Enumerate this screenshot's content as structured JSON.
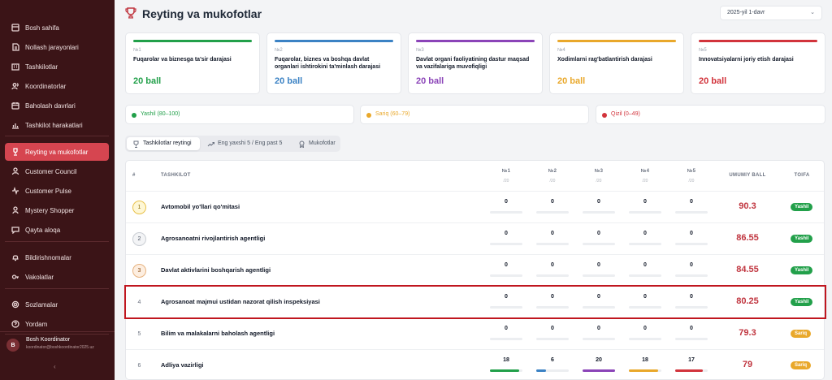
{
  "sidebar": {
    "items": [
      {
        "label": "Bosh sahifa",
        "icon": "home-icon"
      },
      {
        "label": "Nollash jarayonlari",
        "icon": "document-icon"
      },
      {
        "label": "Tashkilotlar",
        "icon": "building-icon"
      },
      {
        "label": "Koordinatorlar",
        "icon": "users-icon"
      },
      {
        "label": "Baholash davrlari",
        "icon": "calendar-icon"
      },
      {
        "label": "Tashkilot harakatlari",
        "icon": "chart-icon"
      },
      {
        "label": "Reyting va mukofotlar",
        "icon": "trophy-icon",
        "active": true
      },
      {
        "label": "Customer Council",
        "icon": "people-icon"
      },
      {
        "label": "Customer Pulse",
        "icon": "pulse-icon"
      },
      {
        "label": "Mystery Shopper",
        "icon": "shopper-icon"
      },
      {
        "label": "Qayta aloqa",
        "icon": "chat-icon"
      },
      {
        "label": "Bildirishnomalar",
        "icon": "bell-icon"
      },
      {
        "label": "Vakolatlar",
        "icon": "key-icon"
      },
      {
        "label": "Sozlamalar",
        "icon": "settings-icon"
      },
      {
        "label": "Yordam",
        "icon": "help-icon"
      }
    ],
    "user": {
      "initial": "B",
      "name": "Bosh Koordinator",
      "email": "koordinator@boshkoordinator2025.uz"
    }
  },
  "header": {
    "title": "Reyting va mukofotlar",
    "period": "2025-yil 1-davr"
  },
  "criteria": [
    {
      "num": "№1",
      "title": "Fuqarolar va biznesga ta'sir darajasi",
      "score": "20 ball",
      "color": "#22a04a"
    },
    {
      "num": "№2",
      "title": "Fuqarolar, biznes va boshqa davlat organlari ishtirokini ta'minlash darajasi",
      "score": "20 ball",
      "color": "#3b82c4"
    },
    {
      "num": "№3",
      "title": "Davlat organi faoliyatining dastur maqsad va vazifalariga muvofiqligi",
      "score": "20 ball",
      "color": "#8b44b8"
    },
    {
      "num": "№4",
      "title": "Xodimlarni rag'batlantirish darajasi",
      "score": "20 ball",
      "color": "#e9a82b"
    },
    {
      "num": "№5",
      "title": "Innovatsiyalarni joriy etish darajasi",
      "score": "20 ball",
      "color": "#d2343c"
    }
  ],
  "legend": [
    {
      "label": "Yashil (80–100)",
      "color": "#22a04a"
    },
    {
      "label": "Sariq (60–79)",
      "color": "#e9a82b"
    },
    {
      "label": "Qizil (0–49)",
      "color": "#d2343c"
    }
  ],
  "tabs": [
    {
      "label": "Tashkilotlar reytingi",
      "active": true
    },
    {
      "label": "Eng yaxshi 5 / Eng past 5"
    },
    {
      "label": "Mukofotlar"
    }
  ],
  "table": {
    "headers": {
      "rank": "#",
      "org": "TASHKILOT",
      "c1": "№1",
      "c2": "№2",
      "c3": "№3",
      "c4": "№4",
      "c5": "№5",
      "sub": "/20",
      "total": "UMUMIY BALL",
      "cat": "TOIFA"
    },
    "rows": [
      {
        "rank": "1",
        "name": "Avtomobil yo'llari qo'mitasi",
        "scores": [
          "0",
          "0",
          "0",
          "0",
          "0"
        ],
        "fills": [
          0,
          0,
          0,
          0,
          0
        ],
        "total": "90.3",
        "cat": "Yashil",
        "catColor": "#22a04a",
        "medal": "gold"
      },
      {
        "rank": "2",
        "name": "Agrosanoatni rivojlantirish agentligi",
        "scores": [
          "0",
          "0",
          "0",
          "0",
          "0"
        ],
        "fills": [
          0,
          0,
          0,
          0,
          0
        ],
        "total": "86.55",
        "cat": "Yashil",
        "catColor": "#22a04a",
        "medal": "silver"
      },
      {
        "rank": "3",
        "name": "Davlat aktivlarini boshqarish agentligi",
        "scores": [
          "0",
          "0",
          "0",
          "0",
          "0"
        ],
        "fills": [
          0,
          0,
          0,
          0,
          0
        ],
        "total": "84.55",
        "cat": "Yashil",
        "catColor": "#22a04a",
        "medal": "bronze"
      },
      {
        "rank": "4",
        "name": "Agrosanoat majmui ustidan nazorat qilish inspeksiyasi",
        "scores": [
          "0",
          "0",
          "0",
          "0",
          "0"
        ],
        "fills": [
          0,
          0,
          0,
          0,
          0
        ],
        "total": "80.25",
        "cat": "Yashil",
        "catColor": "#22a04a",
        "medal": ""
      },
      {
        "rank": "5",
        "name": "Bilim va malakalarni baholash agentligi",
        "scores": [
          "0",
          "0",
          "0",
          "0",
          "0"
        ],
        "fills": [
          0,
          0,
          0,
          0,
          0
        ],
        "total": "79.3",
        "cat": "Sariq",
        "catColor": "#e9a82b",
        "medal": ""
      },
      {
        "rank": "6",
        "name": "Adliya vazirligi",
        "scores": [
          "18",
          "6",
          "20",
          "18",
          "17"
        ],
        "fills": [
          0.9,
          0.3,
          1,
          0.9,
          0.85
        ],
        "total": "79",
        "cat": "Sariq",
        "catColor": "#e9a82b",
        "medal": ""
      }
    ]
  }
}
